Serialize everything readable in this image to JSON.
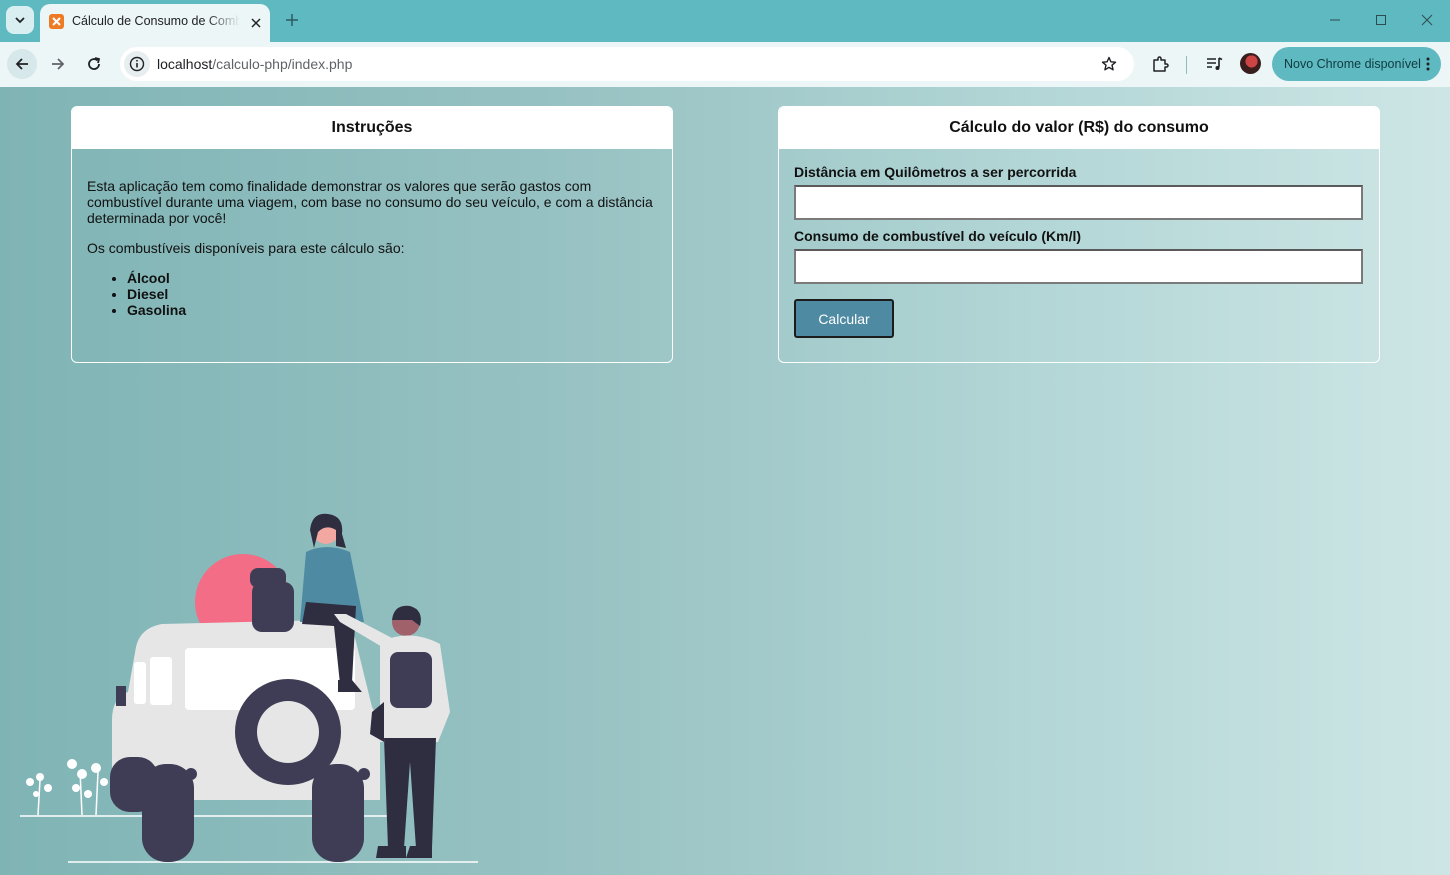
{
  "browser": {
    "tab_title": "Cálculo de Consumo de Combustível",
    "url_host": "localhost",
    "url_path": "/calculo-php/index.php",
    "update_label": "Novo Chrome disponível"
  },
  "instructions": {
    "title": "Instruções",
    "paragraph1": "Esta aplicação tem como finalidade demonstrar os valores que serão gastos com combustível durante uma viagem, com base no consumo do seu veículo, e com a distância determinada por você!",
    "paragraph2": "Os combustíveis disponíveis para este cálculo são:",
    "fuels": [
      "Álcool",
      "Diesel",
      "Gasolina"
    ]
  },
  "calculator": {
    "title": "Cálculo do valor (R$) do consumo",
    "distance_label": "Distância em Quilômetros a ser percorrida",
    "distance_value": "",
    "consumption_label": "Consumo de combustível do veículo (Km/l)",
    "consumption_value": "",
    "button_label": "Calcular"
  },
  "colors": {
    "tabbar": "#5fb9c1",
    "page_start": "#7fb4b5",
    "page_end": "#cde6e5",
    "button": "#4f8aa3",
    "illustration_sun": "#f26d85",
    "illustration_dark": "#3f3d56"
  }
}
